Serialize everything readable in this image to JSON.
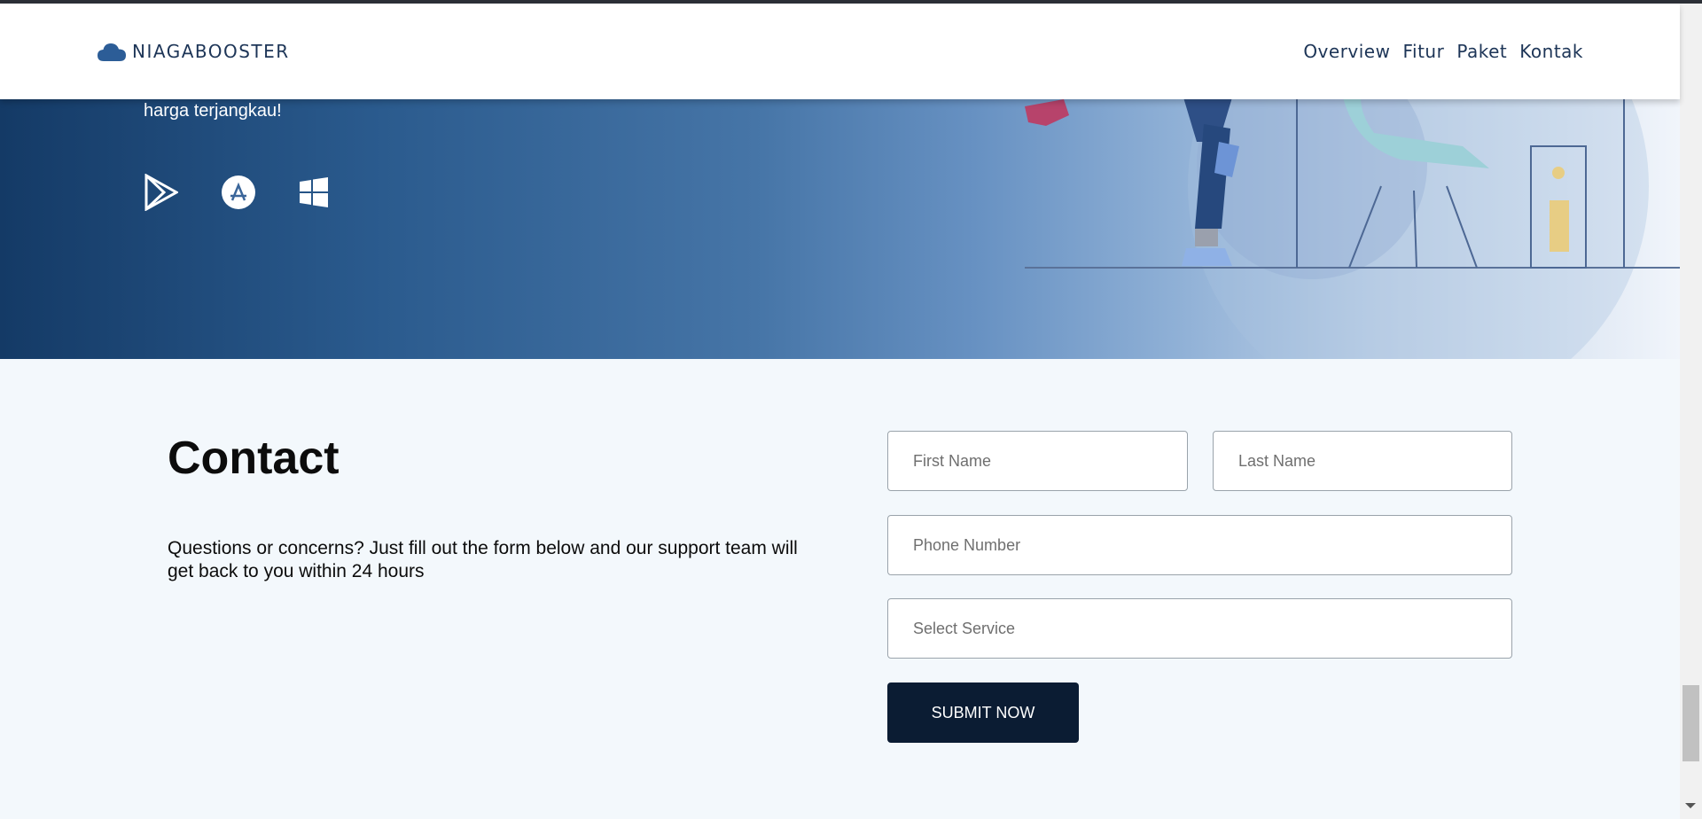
{
  "brand": {
    "name": "NIAGABOOSTER",
    "logo_icon": "cloud-icon",
    "color": "#2c5d97"
  },
  "nav": {
    "items": [
      "Overview",
      "Fitur",
      "Paket",
      "Kontak"
    ]
  },
  "hero": {
    "tagline_fragment": "harga terjangkau!",
    "store_icons": [
      "google-play-icon",
      "app-store-icon",
      "windows-icon"
    ]
  },
  "contact": {
    "title": "Contact",
    "description": "Questions or concerns? Just fill out the form below and our support team will get back to you within 24 hours",
    "form": {
      "first_name_placeholder": "First Name",
      "last_name_placeholder": "Last Name",
      "phone_placeholder": "Phone Number",
      "service_placeholder": "Select Service",
      "submit_label": "SUBMIT NOW"
    }
  },
  "colors": {
    "nav_text": "#1d3557",
    "submit_bg": "#0b1c33",
    "page_bg": "#f3f8fc"
  }
}
